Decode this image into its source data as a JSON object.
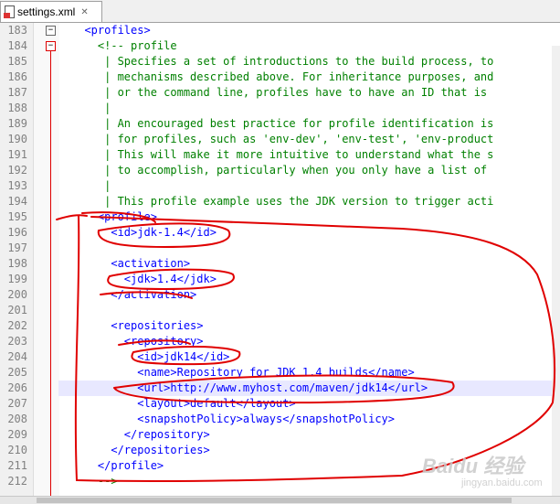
{
  "tab": {
    "label": "settings.xml",
    "close": "✕"
  },
  "lines": [
    {
      "n": "183",
      "indent": "  ",
      "text": "<profiles>",
      "cls": "tag"
    },
    {
      "n": "184",
      "indent": "    ",
      "text": "<!-- profile",
      "cls": "cmt"
    },
    {
      "n": "185",
      "indent": "     ",
      "text": "| Specifies a set of introductions to the build process, to",
      "cls": "cmt"
    },
    {
      "n": "186",
      "indent": "     ",
      "text": "| mechanisms described above. For inheritance purposes, and",
      "cls": "cmt"
    },
    {
      "n": "187",
      "indent": "     ",
      "text": "| or the command line, profiles have to have an ID that is",
      "cls": "cmt"
    },
    {
      "n": "188",
      "indent": "     ",
      "text": "|",
      "cls": "cmt"
    },
    {
      "n": "189",
      "indent": "     ",
      "text": "| An encouraged best practice for profile identification is",
      "cls": "cmt"
    },
    {
      "n": "190",
      "indent": "     ",
      "text": "| for profiles, such as 'env-dev', 'env-test', 'env-product",
      "cls": "cmt"
    },
    {
      "n": "191",
      "indent": "     ",
      "text": "| This will make it more intuitive to understand what the s",
      "cls": "cmt"
    },
    {
      "n": "192",
      "indent": "     ",
      "text": "| to accomplish, particularly when you only have a list of",
      "cls": "cmt"
    },
    {
      "n": "193",
      "indent": "     ",
      "text": "|",
      "cls": "cmt"
    },
    {
      "n": "194",
      "indent": "     ",
      "text": "| This profile example uses the JDK version to trigger acti",
      "cls": "cmt"
    },
    {
      "n": "195",
      "indent": "    ",
      "text": "<profile>",
      "cls": "tag"
    },
    {
      "n": "196",
      "indent": "      ",
      "text": "<id>jdk-1.4</id>",
      "cls": "tag"
    },
    {
      "n": "197",
      "indent": "",
      "text": "",
      "cls": "tag"
    },
    {
      "n": "198",
      "indent": "      ",
      "text": "<activation>",
      "cls": "tag"
    },
    {
      "n": "199",
      "indent": "        ",
      "text": "<jdk>1.4</jdk>",
      "cls": "tag"
    },
    {
      "n": "200",
      "indent": "      ",
      "text": "</activation>",
      "cls": "tag"
    },
    {
      "n": "201",
      "indent": "",
      "text": "",
      "cls": "tag"
    },
    {
      "n": "202",
      "indent": "      ",
      "text": "<repositories>",
      "cls": "tag"
    },
    {
      "n": "203",
      "indent": "        ",
      "text": "<repository>",
      "cls": "tag"
    },
    {
      "n": "204",
      "indent": "          ",
      "text": "<id>jdk14</id>",
      "cls": "tag"
    },
    {
      "n": "205",
      "indent": "          ",
      "text": "<name>Repository for JDK 1.4 builds</name>",
      "cls": "tag"
    },
    {
      "n": "206",
      "indent": "          ",
      "text": "<url>http://www.myhost.com/maven/jdk14</url>",
      "cls": "tag",
      "hl": true
    },
    {
      "n": "207",
      "indent": "          ",
      "text": "<layout>default</layout>",
      "cls": "tag"
    },
    {
      "n": "208",
      "indent": "          ",
      "text": "<snapshotPolicy>always</snapshotPolicy>",
      "cls": "tag"
    },
    {
      "n": "209",
      "indent": "        ",
      "text": "</repository>",
      "cls": "tag"
    },
    {
      "n": "210",
      "indent": "      ",
      "text": "</repositories>",
      "cls": "tag"
    },
    {
      "n": "211",
      "indent": "    ",
      "text": "</profile>",
      "cls": "tag"
    },
    {
      "n": "212",
      "indent": "    ",
      "text": "-->",
      "cls": "cmt"
    }
  ],
  "watermark": {
    "main": "Baidu 经验",
    "sub": "jingyan.baidu.com"
  }
}
